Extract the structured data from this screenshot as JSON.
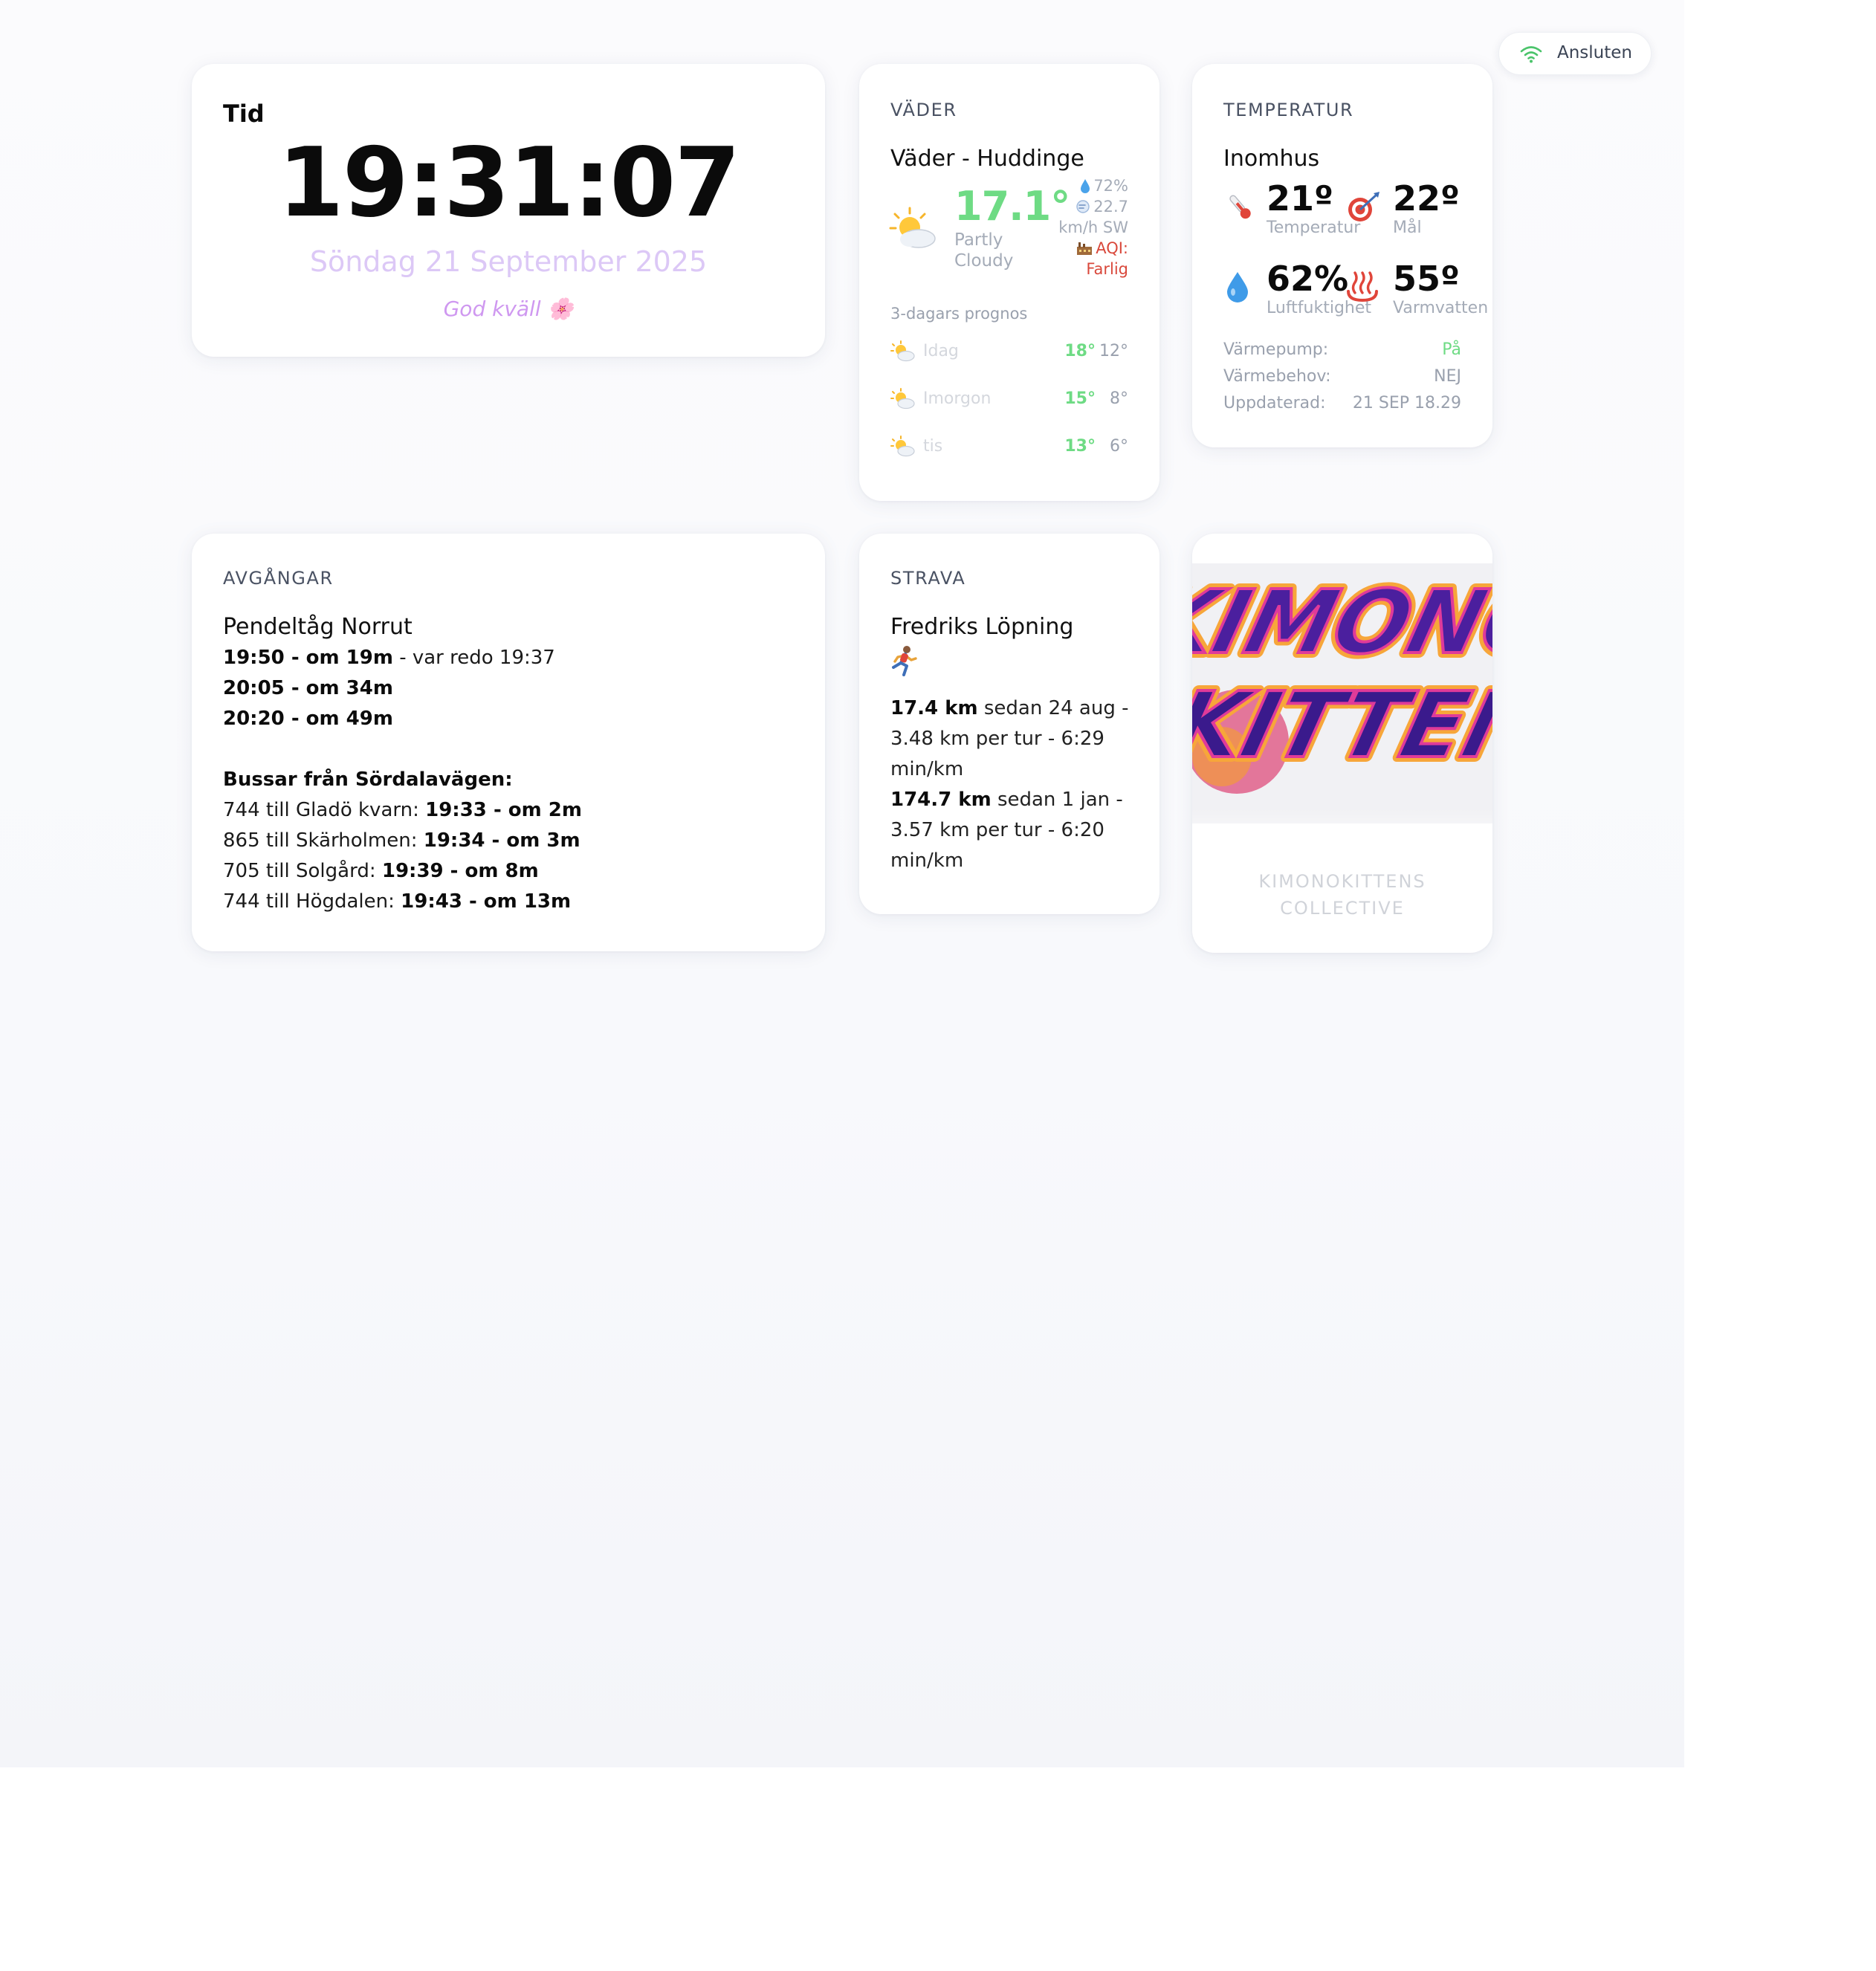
{
  "status": {
    "label": "Ansluten",
    "icon": "wifi-icon",
    "color": "#4bc46b"
  },
  "clock": {
    "title": "Tid",
    "time": "19:31:07",
    "date": "Söndag 21 September 2025",
    "greeting": "God kväll 🌸"
  },
  "weather": {
    "section": "VÄDER",
    "title": "Väder - Huddinge",
    "icon": "partly-cloudy-icon",
    "temp": "17.1°",
    "condition_line1": "Partly",
    "condition_line2": "Cloudy",
    "humidity": "72%",
    "wind_line1": "22.7",
    "wind_line2": "km/h SW",
    "aqi_label": "AQI:",
    "aqi_value": "Farlig",
    "forecast_title": "3-dagars prognos",
    "forecast": [
      {
        "day": "Idag",
        "high": "18°",
        "low": "12°",
        "icon": "partly-cloudy-icon"
      },
      {
        "day": "Imorgon",
        "high": "15°",
        "low": "8°",
        "icon": "partly-cloudy-icon"
      },
      {
        "day": "tis",
        "high": "13°",
        "low": "6°",
        "icon": "partly-cloudy-icon"
      }
    ]
  },
  "temperature": {
    "section": "TEMPERATUR",
    "title": "Inomhus",
    "tiles": [
      {
        "value": "21º",
        "label": "Temperatur",
        "icon": "thermometer-icon"
      },
      {
        "value": "22º",
        "label": "Mål",
        "icon": "target-icon"
      },
      {
        "value": "62%",
        "label": "Luftfuktighet",
        "icon": "droplet-icon"
      },
      {
        "value": "55º",
        "label": "Varmvatten",
        "icon": "hot-springs-icon"
      }
    ],
    "rows": [
      {
        "key": "Värmepump:",
        "value": "På"
      },
      {
        "key": "Värmebehov:",
        "value": "NEJ"
      },
      {
        "key": "Uppdaterad:",
        "value": "21 SEP 18.29"
      }
    ],
    "on_color": "#6edb84"
  },
  "departures": {
    "section": "AVGÅNGAR",
    "title": "Pendeltåg Norrut",
    "trains": [
      {
        "time": "19:50 - om 19m",
        "note": " - var redo 19:37"
      },
      {
        "time": "20:05 - om 34m",
        "note": ""
      },
      {
        "time": "20:20 - om 49m",
        "note": ""
      }
    ],
    "bus_title": "Bussar från Sördalavägen:",
    "buses": [
      {
        "route": "744 till Gladö kvarn: ",
        "time": "19:33 - om 2m"
      },
      {
        "route": "865 till Skärholmen: ",
        "time": "19:34 - om 3m"
      },
      {
        "route": "705 till Solgård: ",
        "time": "19:39 - om 8m"
      },
      {
        "route": "744 till Högdalen: ",
        "time": "19:43 - om 13m"
      }
    ]
  },
  "strava": {
    "section": "STRAVA",
    "title": "Fredriks Löpning",
    "emoji": "🏃",
    "stats": [
      {
        "distance": "17.4 km",
        "line1": " sedan 24 aug -",
        "line2": "3.48 km per tur - 6:29",
        "line3": "min/km"
      },
      {
        "distance": "174.7 km",
        "line1": " sedan 1 jan -",
        "line2": "3.57 km per tur - 6:20",
        "line3": "min/km"
      }
    ]
  },
  "artwork": {
    "line1": "KIMONO",
    "line2": "KITTEN",
    "caption_line1": "KIMONOKITTENS",
    "caption_line2": "COLLECTIVE"
  }
}
